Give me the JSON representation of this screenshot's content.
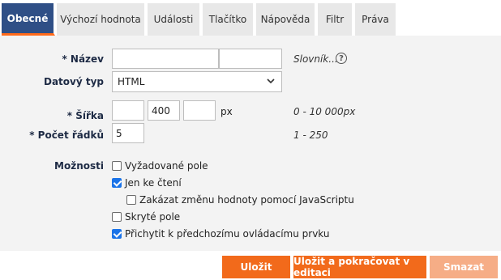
{
  "tabs": [
    {
      "label": "Obecné",
      "active": true
    },
    {
      "label": "Výchozí hodnota"
    },
    {
      "label": "Události"
    },
    {
      "label": "Tlačítko"
    },
    {
      "label": "Nápověda"
    },
    {
      "label": "Filtr"
    },
    {
      "label": "Práva"
    }
  ],
  "form": {
    "nazev": {
      "label": "* Název",
      "value1": "",
      "value2": "",
      "hint": "Slovník..."
    },
    "datovy_typ": {
      "label": "Datový typ",
      "selected": "HTML"
    },
    "sirka": {
      "label": "* Šířka",
      "value1": "",
      "value2": "400",
      "value3": "",
      "unit": "px",
      "hint": "0 - 10 000px"
    },
    "pocet_radku": {
      "label": "* Počet řádků",
      "value": "5",
      "hint": "1 - 250"
    },
    "moznosti": {
      "label": "Možnosti",
      "options": [
        {
          "label": "Vyžadované pole",
          "checked": false
        },
        {
          "label": "Jen ke čtení",
          "checked": true
        },
        {
          "label": "Zakázat změnu hodnoty pomocí JavaScriptu",
          "checked": false
        },
        {
          "label": "Skryté pole",
          "checked": false
        },
        {
          "label": "Přichytit k předchozímu ovládacímu prvku",
          "checked": true
        }
      ]
    }
  },
  "buttons": {
    "ulozit": "Uložit",
    "ulozit_pokracovat": "Uložit a pokračovat v editaci",
    "smazat": "Smazat"
  },
  "colors": {
    "tab_active_bg": "#2f4f86",
    "accent": "#f26a1b",
    "disabled": "#f6ad86",
    "checkbox": "#1a73e8"
  }
}
